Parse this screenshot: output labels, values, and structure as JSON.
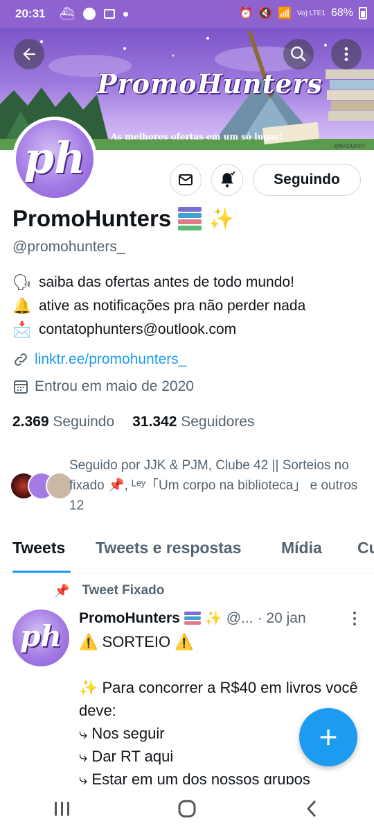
{
  "status_bar": {
    "time": "20:31",
    "network": "Vo) LTE1",
    "battery": "68%"
  },
  "banner": {
    "title": "PromoHunters",
    "subtitle": "As melhores ofertas em um só lugar!",
    "credit": "@BADUART",
    "back_icon": "arrow-left-icon",
    "search_icon": "search-icon",
    "more_icon": "more-vertical-icon"
  },
  "avatar": {
    "text": "ph"
  },
  "actions": {
    "follow_label": "Seguindo",
    "message_icon": "mail-icon",
    "notify_icon": "bell-icon"
  },
  "profile": {
    "name": "PromoHunters",
    "handle": "@promohunters_",
    "bio": [
      {
        "icon": "🗣",
        "text": "saiba das ofertas antes de todo mundo!"
      },
      {
        "icon": "🔔",
        "text": "ative as notificações pra não perder nada"
      },
      {
        "icon": "📩",
        "text": "contatophunters@outlook.com"
      }
    ],
    "link": "linktr.ee/promohunters_",
    "joined": "Entrou em maio de 2020",
    "following_count": "2.369",
    "following_label": "Seguindo",
    "followers_count": "31.342",
    "followers_label": "Seguidores",
    "followed_by": "Seguido por JJK & PJM, Clube 42 || Sorteios no fixado 📌, ᴸᵉʸ「Um corpo na biblioteca」 e outros 12"
  },
  "tabs": [
    "Tweets",
    "Tweets e respostas",
    "Mídia",
    "Cu"
  ],
  "tweet": {
    "pinned_label": "Tweet Fixado",
    "name": "PromoHunters",
    "handle": "@...",
    "date": "· 20 jan",
    "lines": [
      "⚠️ SORTEIO ⚠️",
      "",
      "✨ Para concorrer a R$40 em livros você deve:",
      "⤷ Nos seguir",
      "⤷ Dar RT aqui",
      "⤷ Estar em um dos nossos grupos"
    ]
  },
  "colors": {
    "accent": "#1d9bf0",
    "banner": "#8e63cf",
    "text": "#0f1419",
    "muted": "#536471"
  }
}
